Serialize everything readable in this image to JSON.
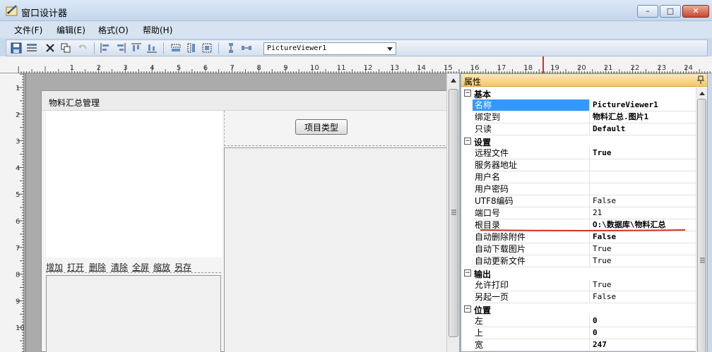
{
  "window": {
    "title": "窗口设计器",
    "minimize": "–",
    "maximize": "□",
    "close": "✕"
  },
  "menu": [
    "文件(F)",
    "编辑(E)",
    "格式(O)",
    "帮助(H)"
  ],
  "toolbar": {
    "component_select": "PictureViewer1"
  },
  "rulers": {
    "horizontal": [
      "1",
      "2",
      "3",
      "4",
      "5",
      "6",
      "7",
      "8",
      "9",
      "10",
      "11",
      "12",
      "13",
      "14",
      "15",
      "16",
      "17",
      "18",
      "19",
      "20",
      "21",
      "22",
      "23",
      "24"
    ],
    "vertical": [
      "1",
      "2",
      "3",
      "4",
      "5",
      "6",
      "7",
      "8",
      "9",
      "10"
    ]
  },
  "form": {
    "title": "物料汇总管理",
    "links": [
      "增加",
      "打开",
      "删除",
      "清除",
      "全屏",
      "缩放",
      "另存"
    ],
    "type_button": "项目类型"
  },
  "properties": {
    "title": "属性",
    "pin": "ᵖ",
    "categories": [
      {
        "label": "基本",
        "rows": [
          {
            "name": "名称",
            "value": "PictureViewer1",
            "bold": true,
            "selected": true
          },
          {
            "name": "绑定到",
            "value": "物料汇总.图片1",
            "bold": true
          },
          {
            "name": "只读",
            "value": "Default",
            "bold": true
          }
        ]
      },
      {
        "label": "设置",
        "rows": [
          {
            "name": "远程文件",
            "value": "True",
            "bold": true
          },
          {
            "name": "服务器地址",
            "value": ""
          },
          {
            "name": "用户名",
            "value": ""
          },
          {
            "name": "用户密码",
            "value": ""
          },
          {
            "name": "UTF8编码",
            "value": "False"
          },
          {
            "name": "端口号",
            "value": "21"
          },
          {
            "name": "根目录",
            "value": "O:\\数据库\\物料汇总",
            "bold": true
          },
          {
            "name": "自动删除附件",
            "value": "False",
            "bold": true
          },
          {
            "name": "自动下载图片",
            "value": "True"
          },
          {
            "name": "自动更新文件",
            "value": "True"
          }
        ]
      },
      {
        "label": "输出",
        "rows": [
          {
            "name": "允许打印",
            "value": "True"
          },
          {
            "name": "另起一页",
            "value": "False"
          }
        ]
      },
      {
        "label": "位置",
        "rows": [
          {
            "name": "左",
            "value": "0",
            "bold": true
          },
          {
            "name": "上",
            "value": "0",
            "bold": true
          },
          {
            "name": "宽",
            "value": "247",
            "bold": true
          }
        ]
      }
    ]
  },
  "colors": {
    "selection": "#3399ff",
    "annotation": "#d0302a",
    "panel_header": "#f5c769"
  }
}
